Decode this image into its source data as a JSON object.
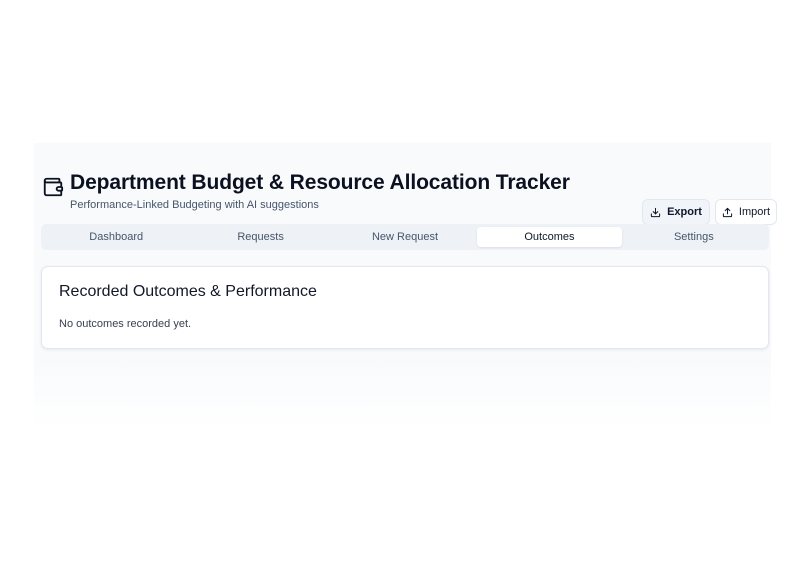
{
  "header": {
    "title": "Department Budget & Resource Allocation Tracker",
    "subtitle": "Performance-Linked Budgeting with AI suggestions",
    "icon": "wallet-icon"
  },
  "actions": {
    "export_label": "Export",
    "import_label": "Import"
  },
  "tabs": [
    {
      "label": "Dashboard",
      "active": false
    },
    {
      "label": "Requests",
      "active": false
    },
    {
      "label": "New Request",
      "active": false
    },
    {
      "label": "Outcomes",
      "active": true
    },
    {
      "label": "Settings",
      "active": false
    }
  ],
  "outcomes": {
    "title": "Recorded Outcomes & Performance",
    "empty_message": "No outcomes recorded yet."
  }
}
